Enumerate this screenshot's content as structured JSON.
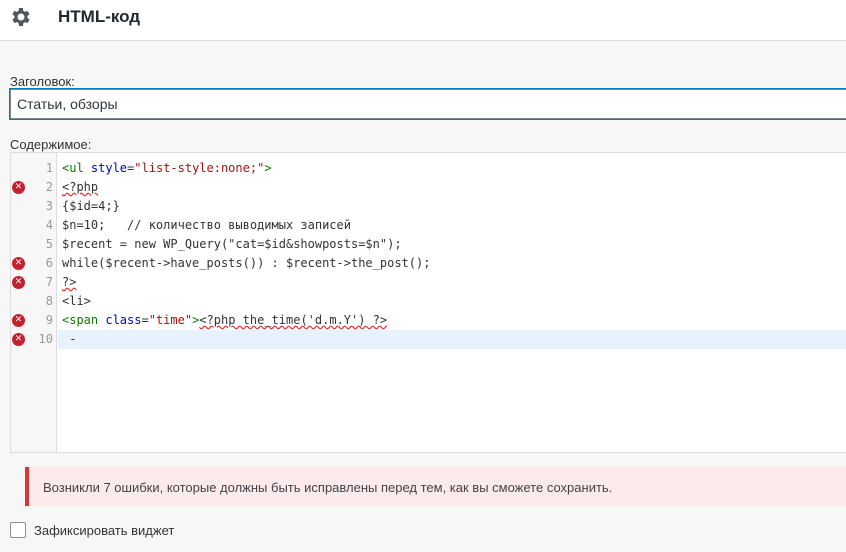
{
  "header": {
    "title": "HTML-код",
    "icon": "gear-icon"
  },
  "form": {
    "title_label": "Заголовок:",
    "title_value": "Статьи, обзоры",
    "content_label": "Содержимое:"
  },
  "editor": {
    "lines": [
      {
        "num": "1",
        "error": false
      },
      {
        "num": "2",
        "error": true
      },
      {
        "num": "3",
        "error": false
      },
      {
        "num": "4",
        "error": false
      },
      {
        "num": "5",
        "error": false
      },
      {
        "num": "6",
        "error": true
      },
      {
        "num": "7",
        "error": true
      },
      {
        "num": "8",
        "error": false
      },
      {
        "num": "9",
        "error": true
      },
      {
        "num": "10",
        "error": true
      }
    ],
    "code": {
      "l1_tag_open": "<ul ",
      "l1_attr": "style",
      "l1_eq": "=",
      "l1_str": "\"list-style:none;\"",
      "l1_tag_close": ">",
      "l2": "<?php",
      "l3": "{$id=4;}",
      "l4": "$n=10;   // количество выводимых записей",
      "l5": "$recent = new WP_Query(\"cat=$id&showposts=$n\");",
      "l6": "while($recent->have_posts()) : $recent->the_post();",
      "l7": "?>",
      "l8": "<li>",
      "l9_tag_open": "<span ",
      "l9_attr": "class",
      "l9_eq": "=",
      "l9_str": "\"time\"",
      "l9_tag_close": ">",
      "l9_rest": "<?php the_time('d.m.Y') ?>",
      "l10": " -"
    }
  },
  "notice": {
    "text": "Возникли 7 ошибки, которые должны быть исправлены перед тем, как вы сможете сохранить."
  },
  "checkbox": {
    "label": "Зафиксировать виджет",
    "checked": false
  }
}
